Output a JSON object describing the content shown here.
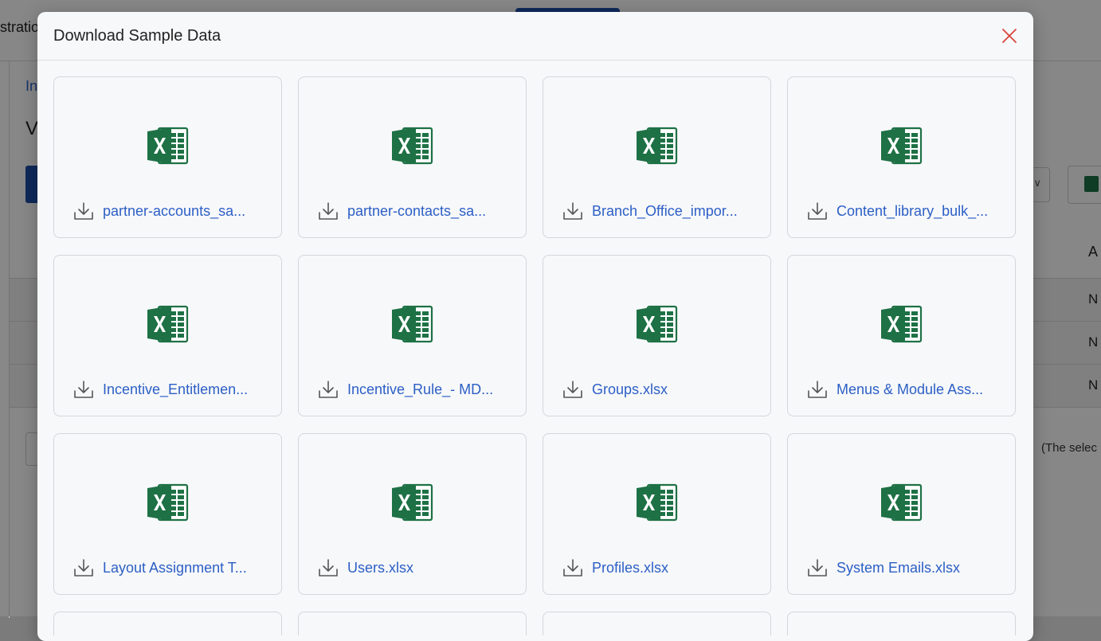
{
  "background": {
    "topbar_text": "stratio",
    "breadcrumb": "In",
    "heading": "V",
    "column_header": "A",
    "row_values": [
      "N",
      "N",
      "N"
    ],
    "note": "(The selec"
  },
  "modal": {
    "title": "Download Sample Data",
    "files": [
      {
        "name": "partner-accounts_sa..."
      },
      {
        "name": "partner-contacts_sa..."
      },
      {
        "name": "Branch_Office_impor..."
      },
      {
        "name": "Content_library_bulk_..."
      },
      {
        "name": "Incentive_Entitlemen..."
      },
      {
        "name": "Incentive_Rule_- MD..."
      },
      {
        "name": "Groups.xlsx"
      },
      {
        "name": "Menus & Module Ass..."
      },
      {
        "name": "Layout Assignment T..."
      },
      {
        "name": "Users.xlsx"
      },
      {
        "name": "Profiles.xlsx"
      },
      {
        "name": "System Emails.xlsx"
      }
    ]
  },
  "colors": {
    "excel_green": "#1e7145",
    "link_blue": "#2c5fc5",
    "close_red": "#d9443a"
  },
  "icons": {
    "file": "excel-icon",
    "download": "download-icon",
    "close": "close-icon"
  }
}
